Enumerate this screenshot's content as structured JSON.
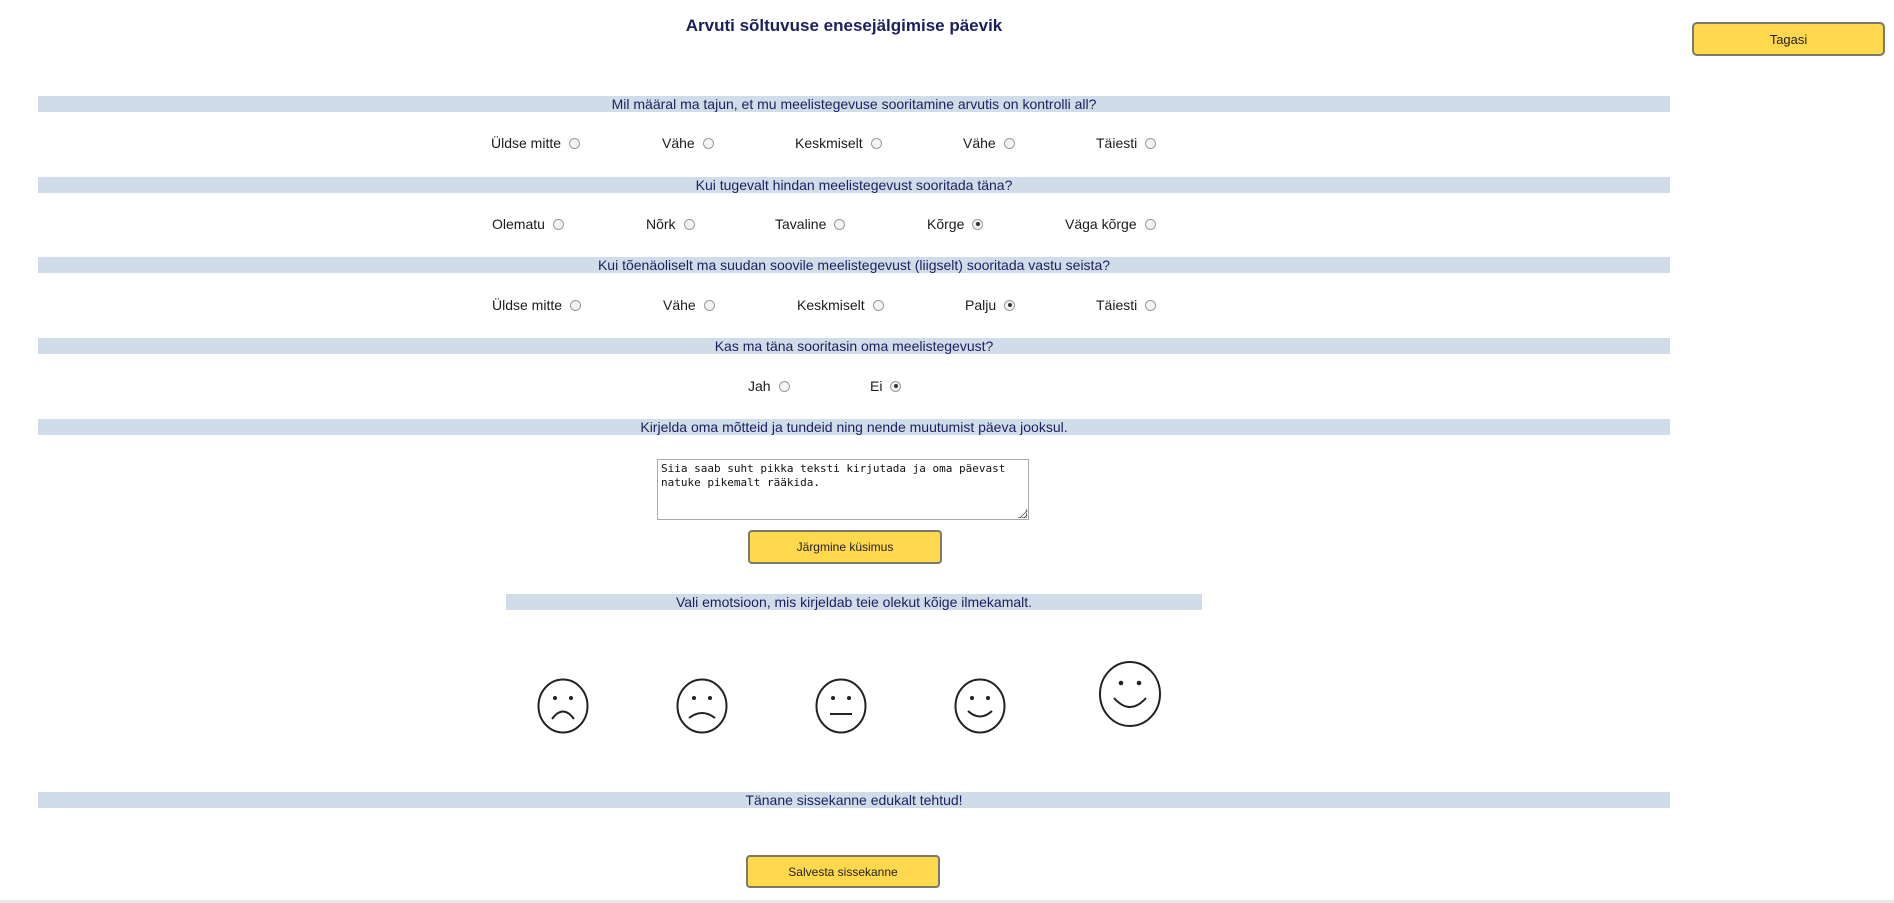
{
  "page": {
    "title": "Arvuti sõltuvuse enesejälgimise päevik",
    "back_label": "Tagasi"
  },
  "questions": [
    {
      "text": "Mil määral ma tajun, et mu meelistegevuse sooritamine arvutis on kontrolli all?",
      "options": [
        "Üldse mitte",
        "Vähe",
        "Keskmiselt",
        "Vähe",
        "Täiesti"
      ],
      "selected": null
    },
    {
      "text": "Kui tugevalt hindan meelistegevust sooritada täna?",
      "options": [
        "Olematu",
        "Nõrk",
        "Tavaline",
        "Kõrge",
        "Väga kõrge"
      ],
      "selected": 3
    },
    {
      "text": "Kui tõenäoliselt ma suudan soovile meelistegevust (liigselt) sooritada vastu seista?",
      "options": [
        "Üldse mitte",
        "Vähe",
        "Keskmiselt",
        "Palju",
        "Täiesti"
      ],
      "selected": 3
    },
    {
      "text": "Kas ma täna sooritasin oma meelistegevust?",
      "options": [
        "Jah",
        "Ei"
      ],
      "selected": 1
    }
  ],
  "notes": {
    "question": "Kirjelda oma mõtteid ja tundeid ning nende muutumist päeva jooksul.",
    "value": "Siia saab suht pikka teksti kirjutada ja oma päevast natuke pikemalt rääkida.",
    "next_label": "Järgmine küsimus"
  },
  "emotion": {
    "question": "Vali emotsioon, mis kirjeldab teie olekut kõige ilmekamalt.",
    "faces": [
      "very-sad-face-icon",
      "sad-face-icon",
      "neutral-face-icon",
      "smile-face-icon",
      "happy-face-icon"
    ]
  },
  "status": {
    "message": "Tänane sissekanne edukalt tehtud!",
    "save_label": "Salvesta sissekanne"
  }
}
